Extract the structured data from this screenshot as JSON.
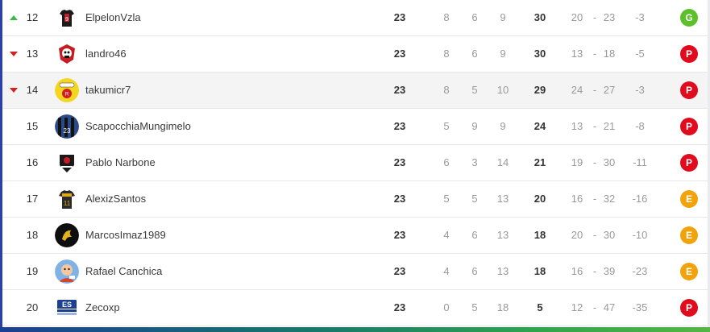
{
  "standings": {
    "rows": [
      {
        "trend": "up",
        "pos": "12",
        "team": "ElpelonVzla",
        "pj": "23",
        "w": "8",
        "d": "6",
        "l": "9",
        "pts": "30",
        "gf": "20",
        "ga": "23",
        "gd": "-3",
        "result": "G",
        "result_color": "#5cc02b",
        "logo_icon": "jersey-black-red-icon"
      },
      {
        "trend": "down",
        "pos": "13",
        "team": "landro46",
        "pj": "23",
        "w": "8",
        "d": "6",
        "l": "9",
        "pts": "30",
        "gf": "13",
        "ga": "18",
        "gd": "-5",
        "result": "P",
        "result_color": "#e00b1c",
        "logo_icon": "skull-crest-icon"
      },
      {
        "trend": "down",
        "pos": "14",
        "team": "takumicr7",
        "pj": "23",
        "w": "8",
        "d": "5",
        "l": "10",
        "pts": "29",
        "gf": "24",
        "ga": "27",
        "gd": "-3",
        "result": "P",
        "result_color": "#e00b1c",
        "logo_icon": "yellow-red-crest-icon",
        "highlighted": true
      },
      {
        "trend": "",
        "pos": "15",
        "team": "ScapocchiaMungimelo",
        "pj": "23",
        "w": "5",
        "d": "9",
        "l": "9",
        "pts": "24",
        "gf": "13",
        "ga": "21",
        "gd": "-8",
        "result": "P",
        "result_color": "#e00b1c",
        "logo_icon": "striped-jersey-icon"
      },
      {
        "trend": "",
        "pos": "16",
        "team": "Pablo Narbone",
        "pj": "23",
        "w": "6",
        "d": "3",
        "l": "14",
        "pts": "21",
        "gf": "19",
        "ga": "30",
        "gd": "-11",
        "result": "P",
        "result_color": "#e00b1c",
        "logo_icon": "dark-crest-icon"
      },
      {
        "trend": "",
        "pos": "17",
        "team": "AlexizSantos",
        "pj": "23",
        "w": "5",
        "d": "5",
        "l": "13",
        "pts": "20",
        "gf": "16",
        "ga": "32",
        "gd": "-16",
        "result": "E",
        "result_color": "#f0a30a",
        "logo_icon": "jersey-number-11-icon"
      },
      {
        "trend": "",
        "pos": "18",
        "team": "MarcosImaz1989",
        "pj": "23",
        "w": "4",
        "d": "6",
        "l": "13",
        "pts": "18",
        "gf": "20",
        "ga": "30",
        "gd": "-10",
        "result": "E",
        "result_color": "#f0a30a",
        "logo_icon": "black-gold-emblem-icon"
      },
      {
        "trend": "",
        "pos": "19",
        "team": "Rafael Canchica",
        "pj": "23",
        "w": "4",
        "d": "6",
        "l": "13",
        "pts": "18",
        "gf": "16",
        "ga": "39",
        "gd": "-23",
        "result": "E",
        "result_color": "#f0a30a",
        "logo_icon": "cartoon-avatar-icon"
      },
      {
        "trend": "",
        "pos": "20",
        "team": "Zecoxp",
        "pj": "23",
        "w": "0",
        "d": "5",
        "l": "18",
        "pts": "5",
        "gf": "12",
        "ga": "47",
        "gd": "-35",
        "result": "P",
        "result_color": "#e00b1c",
        "logo_icon": "es-badge-icon"
      }
    ]
  },
  "theme": {
    "accent_left": "#2a3fb0",
    "win_color": "#5cc02b",
    "loss_color": "#e00b1c",
    "draw_color": "#f0a30a"
  }
}
